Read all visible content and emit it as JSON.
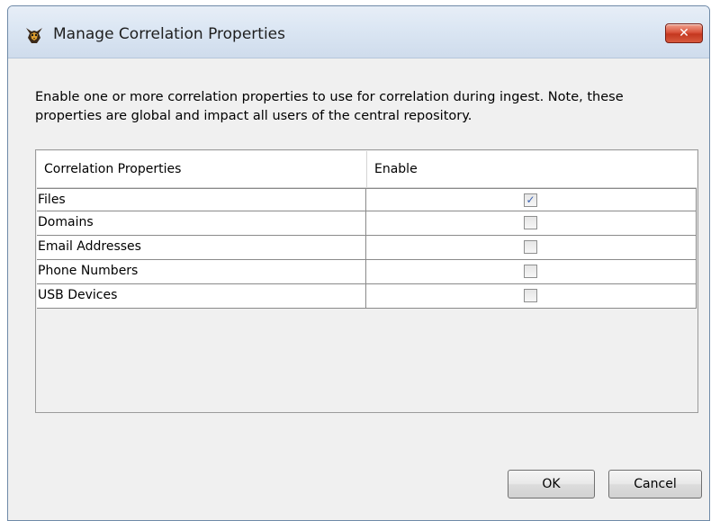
{
  "window": {
    "title": "Manage Correlation Properties",
    "close_glyph": "✕",
    "icon": "autopsy-dog-icon"
  },
  "instructions": "Enable one or more correlation properties to use for correlation during ingest. Note, these properties are global and impact all users of the central repository.",
  "table": {
    "columns": [
      "Correlation Properties",
      "Enable"
    ],
    "rows": [
      {
        "name": "Files",
        "enabled": true
      },
      {
        "name": "Domains",
        "enabled": false
      },
      {
        "name": "Email Addresses",
        "enabled": false
      },
      {
        "name": "Phone Numbers",
        "enabled": false
      },
      {
        "name": "USB Devices",
        "enabled": false
      }
    ]
  },
  "buttons": {
    "ok": "OK",
    "cancel": "Cancel"
  },
  "colors": {
    "checkmark": "#3d63b0",
    "close_button": "#d9533b"
  }
}
